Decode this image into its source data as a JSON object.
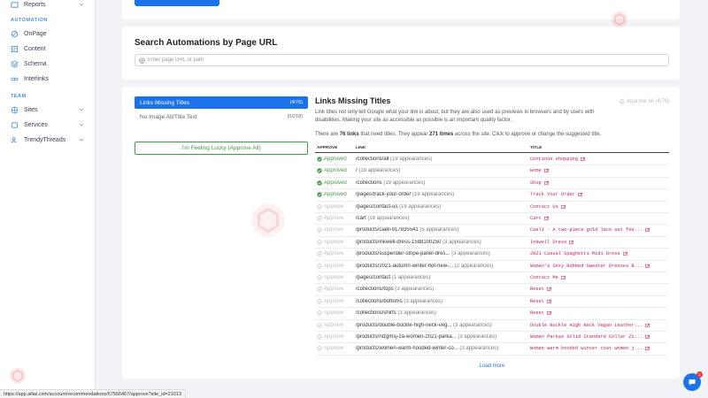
{
  "sidebar": {
    "reports_label": "Reports",
    "section_automation": "AUTOMATION",
    "onpage_label": "OnPage",
    "content_label": "Content",
    "schema_label": "Schema",
    "interlinks_label": "Interlinks",
    "section_team": "TEAM",
    "sites_label": "Sites",
    "services_label": "Services",
    "trendythreads_label": "TrendyThreads"
  },
  "search": {
    "title": "Search Automations by Page URL",
    "placeholder": "Enter page URL or path"
  },
  "tabs": [
    {
      "label": "Links Missing Titles",
      "count": "(4/76)"
    },
    {
      "label": "No Image Alt/Title Text",
      "count": "(0/218)"
    }
  ],
  "lucky_button": "I'm Feeling Lucky (Approve All)",
  "panel": {
    "title": "Links Missing Titles",
    "approve_all": "Approve All (4/76)",
    "description": "Link titles not only tell Google what your link is about, but they are also used as previews in browsers and by users with disabilities. Making your site as accessible as possible is an important quality factor.",
    "summary_pre": "There are ",
    "summary_links": "76 links",
    "summary_mid": " that need titles. They appear ",
    "summary_times": "271 times",
    "summary_post": " across the site. Click to approve or change the suggested title."
  },
  "table": {
    "headers": {
      "approve": "APPROVE",
      "link": "LINK",
      "title": "TITLE"
    },
    "rows": [
      {
        "status": "Approved",
        "approved": true,
        "link": "/collections/all",
        "appearances": "(19 appearances)",
        "title": "Continue shopping"
      },
      {
        "status": "Approved",
        "approved": true,
        "link": "/",
        "appearances": "(19 appearances)",
        "title": "Home"
      },
      {
        "status": "Approved",
        "approved": true,
        "link": "/collections",
        "appearances": "(19 appearances)",
        "title": "Shop"
      },
      {
        "status": "Approved",
        "approved": true,
        "link": "/pages/track-your-order",
        "appearances": "(19 appearances)",
        "title": "Track Your Order"
      },
      {
        "status": "Approve",
        "approved": false,
        "link": "/pages/contact-us",
        "appearances": "(19 appearances)",
        "title": "Contact Us"
      },
      {
        "status": "Approve",
        "approved": false,
        "link": "/cart",
        "appearances": "(19 appearances)",
        "title": "Cart"
      },
      {
        "status": "Approve",
        "approved": false,
        "link": "/products/caeli-917835541",
        "appearances": "(5 appearances)",
        "title": "Caeli - A two-piece gold lace set fea..."
      },
      {
        "status": "Approve",
        "approved": false,
        "link": "/products/inkwell-dress-1588100250",
        "appearances": "(3 appearances)",
        "title": "Inkwell Dress"
      },
      {
        "status": "Approve",
        "approved": false,
        "link": "/products/suspender-stripe-panel-dres...",
        "appearances": "(3 appearances)",
        "title": "2021 Casual Spaghetti Midi Dress"
      },
      {
        "status": "Approve",
        "approved": false,
        "link": "/products/2021-autumn-winter-hot-new-...",
        "appearances": "(2 appearances)",
        "title": "Women's Sexy Ribbed Sweater Dresses B..."
      },
      {
        "status": "Approve",
        "approved": false,
        "link": "/pages/contact",
        "appearances": "(1 appearances)",
        "title": "Contact Me"
      },
      {
        "status": "Approve",
        "approved": false,
        "link": "/collections/tops",
        "appearances": "(3 appearances)",
        "title": "Reset"
      },
      {
        "status": "Approve",
        "approved": false,
        "link": "/collections/bottoms",
        "appearances": "(3 appearances)",
        "title": "Reset"
      },
      {
        "status": "Approve",
        "approved": false,
        "link": "/collections/shirts",
        "appearances": "(3 appearances)",
        "title": "Reset"
      },
      {
        "status": "Approve",
        "approved": false,
        "link": "/products/double-buckle-high-neck-veg...",
        "appearances": "(3 appearances)",
        "title": "Double Buckle High Neck Vegan Leather..."
      },
      {
        "status": "Approve",
        "approved": false,
        "link": "/products/nlzgmsj-za-women-2021-parka...",
        "appearances": "(3 appearances)",
        "title": "Women Parkas Solid Standard Collar Zi..."
      },
      {
        "status": "Approve",
        "approved": false,
        "link": "/products/women-warm-hooded-winter-co...",
        "appearances": "(3 appearances)",
        "title": "Women warm hooded winter coat women j..."
      }
    ],
    "load_more": "Load more"
  },
  "status_url": "https://app.alliai.com/account/recommendations/67566467/approve?site_id=21013",
  "chat_badge": "1",
  "colors": {
    "primary": "#1a73e8",
    "approved": "#3e9b48",
    "title_text": "#c2185b"
  }
}
